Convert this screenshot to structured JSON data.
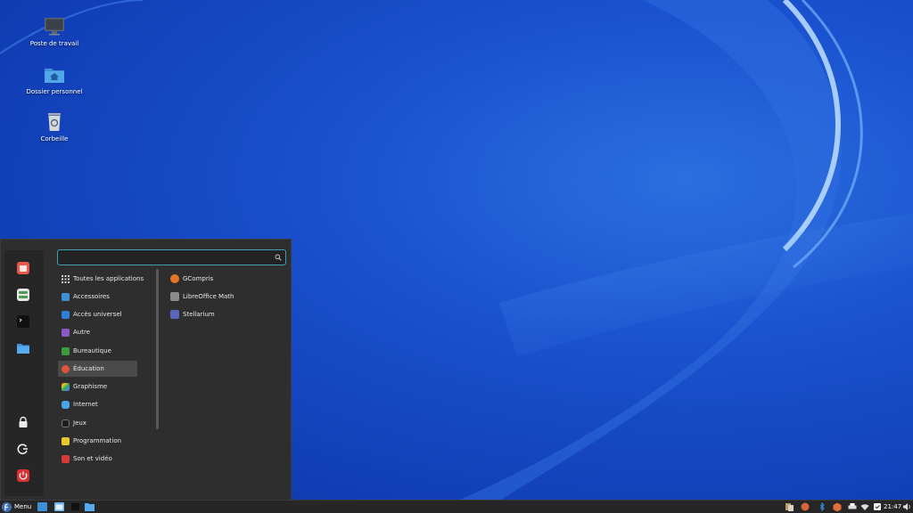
{
  "desktop": {
    "icons": [
      {
        "label": "Poste de travail",
        "icon": "computer-icon"
      },
      {
        "label": "Dossier personnel",
        "icon": "home-folder-icon"
      },
      {
        "label": "Corbeille",
        "icon": "trash-icon"
      }
    ]
  },
  "menu": {
    "search": {
      "value": "",
      "placeholder": ""
    },
    "favorites": [
      "software-manager-icon",
      "system-settings-icon",
      "terminal-icon",
      "files-icon"
    ],
    "session": [
      "lock-icon",
      "logout-icon",
      "power-icon"
    ],
    "categories": [
      {
        "label": "Toutes les applications",
        "icon": "grid-icon",
        "color": "#9e9e9e"
      },
      {
        "label": "Accessoires",
        "icon": "accessories-icon",
        "color": "#3d8fd6"
      },
      {
        "label": "Accès universel",
        "icon": "accessibility-icon",
        "color": "#2f7fd9"
      },
      {
        "label": "Autre",
        "icon": "other-icon",
        "color": "#8b57c9"
      },
      {
        "label": "Bureautique",
        "icon": "office-icon",
        "color": "#3b9a3e"
      },
      {
        "label": "Éducation",
        "icon": "education-icon",
        "color": "#e0533a"
      },
      {
        "label": "Graphisme",
        "icon": "graphics-icon",
        "color": "#d34bb4"
      },
      {
        "label": "Internet",
        "icon": "internet-icon",
        "color": "#4aa5e8"
      },
      {
        "label": "Jeux",
        "icon": "games-icon",
        "color": "#1e1e1e"
      },
      {
        "label": "Programmation",
        "icon": "programming-icon",
        "color": "#e8c92a"
      },
      {
        "label": "Son et vidéo",
        "icon": "multimedia-icon",
        "color": "#d63a3a"
      }
    ],
    "active_category": "Éducation",
    "apps": [
      {
        "label": "GCompris",
        "icon": "gcompris-icon",
        "color": "#e8742a"
      },
      {
        "label": "LibreOffice Math",
        "icon": "libreoffice-math-icon",
        "color": "#8a8a8a"
      },
      {
        "label": "Stellarium",
        "icon": "stellarium-icon",
        "color": "#5a67b8"
      }
    ]
  },
  "taskbar": {
    "menu_label": "Menu",
    "clock": "21:47",
    "launchers": [
      "show-desktop-icon",
      "browser-icon",
      "terminal-icon",
      "files-icon"
    ],
    "tray": [
      "clipboard-icon",
      "update-icon",
      "bluetooth-icon",
      "package-icon",
      "printer-icon",
      "wifi-icon",
      "notes-icon",
      "volume-icon"
    ]
  }
}
